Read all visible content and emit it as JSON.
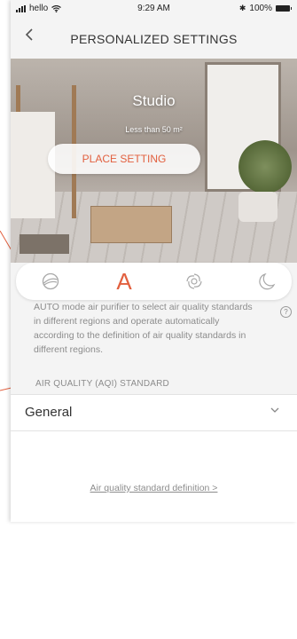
{
  "status_bar": {
    "carrier": "hello",
    "time": "9:29 AM",
    "battery": "100%"
  },
  "header": {
    "back_icon": "chevron-left-icon",
    "title": "PERSONALIZED SETTINGS"
  },
  "hero": {
    "room_name": "Studio",
    "area": "Less than 50 m²",
    "button_label": "PLACE SETTING"
  },
  "modes": {
    "items": [
      {
        "name": "off",
        "icon": "power-mode-icon"
      },
      {
        "name": "auto",
        "label": "A"
      },
      {
        "name": "fan",
        "icon": "swirl-icon"
      },
      {
        "name": "sleep",
        "icon": "moon-icon"
      }
    ],
    "selected": "auto"
  },
  "description": "AUTO mode  air purifier to select air quality standards in different regions and operate automatically according to the definition of air quality standards in different regions.",
  "aqi_section": {
    "label": "AIR QUALITY (AQI) STANDARD",
    "selected": "General"
  },
  "footer_link": "Air quality standard definition >",
  "colors": {
    "accent": "#e2603f",
    "muted_text": "#8c8c8c"
  }
}
